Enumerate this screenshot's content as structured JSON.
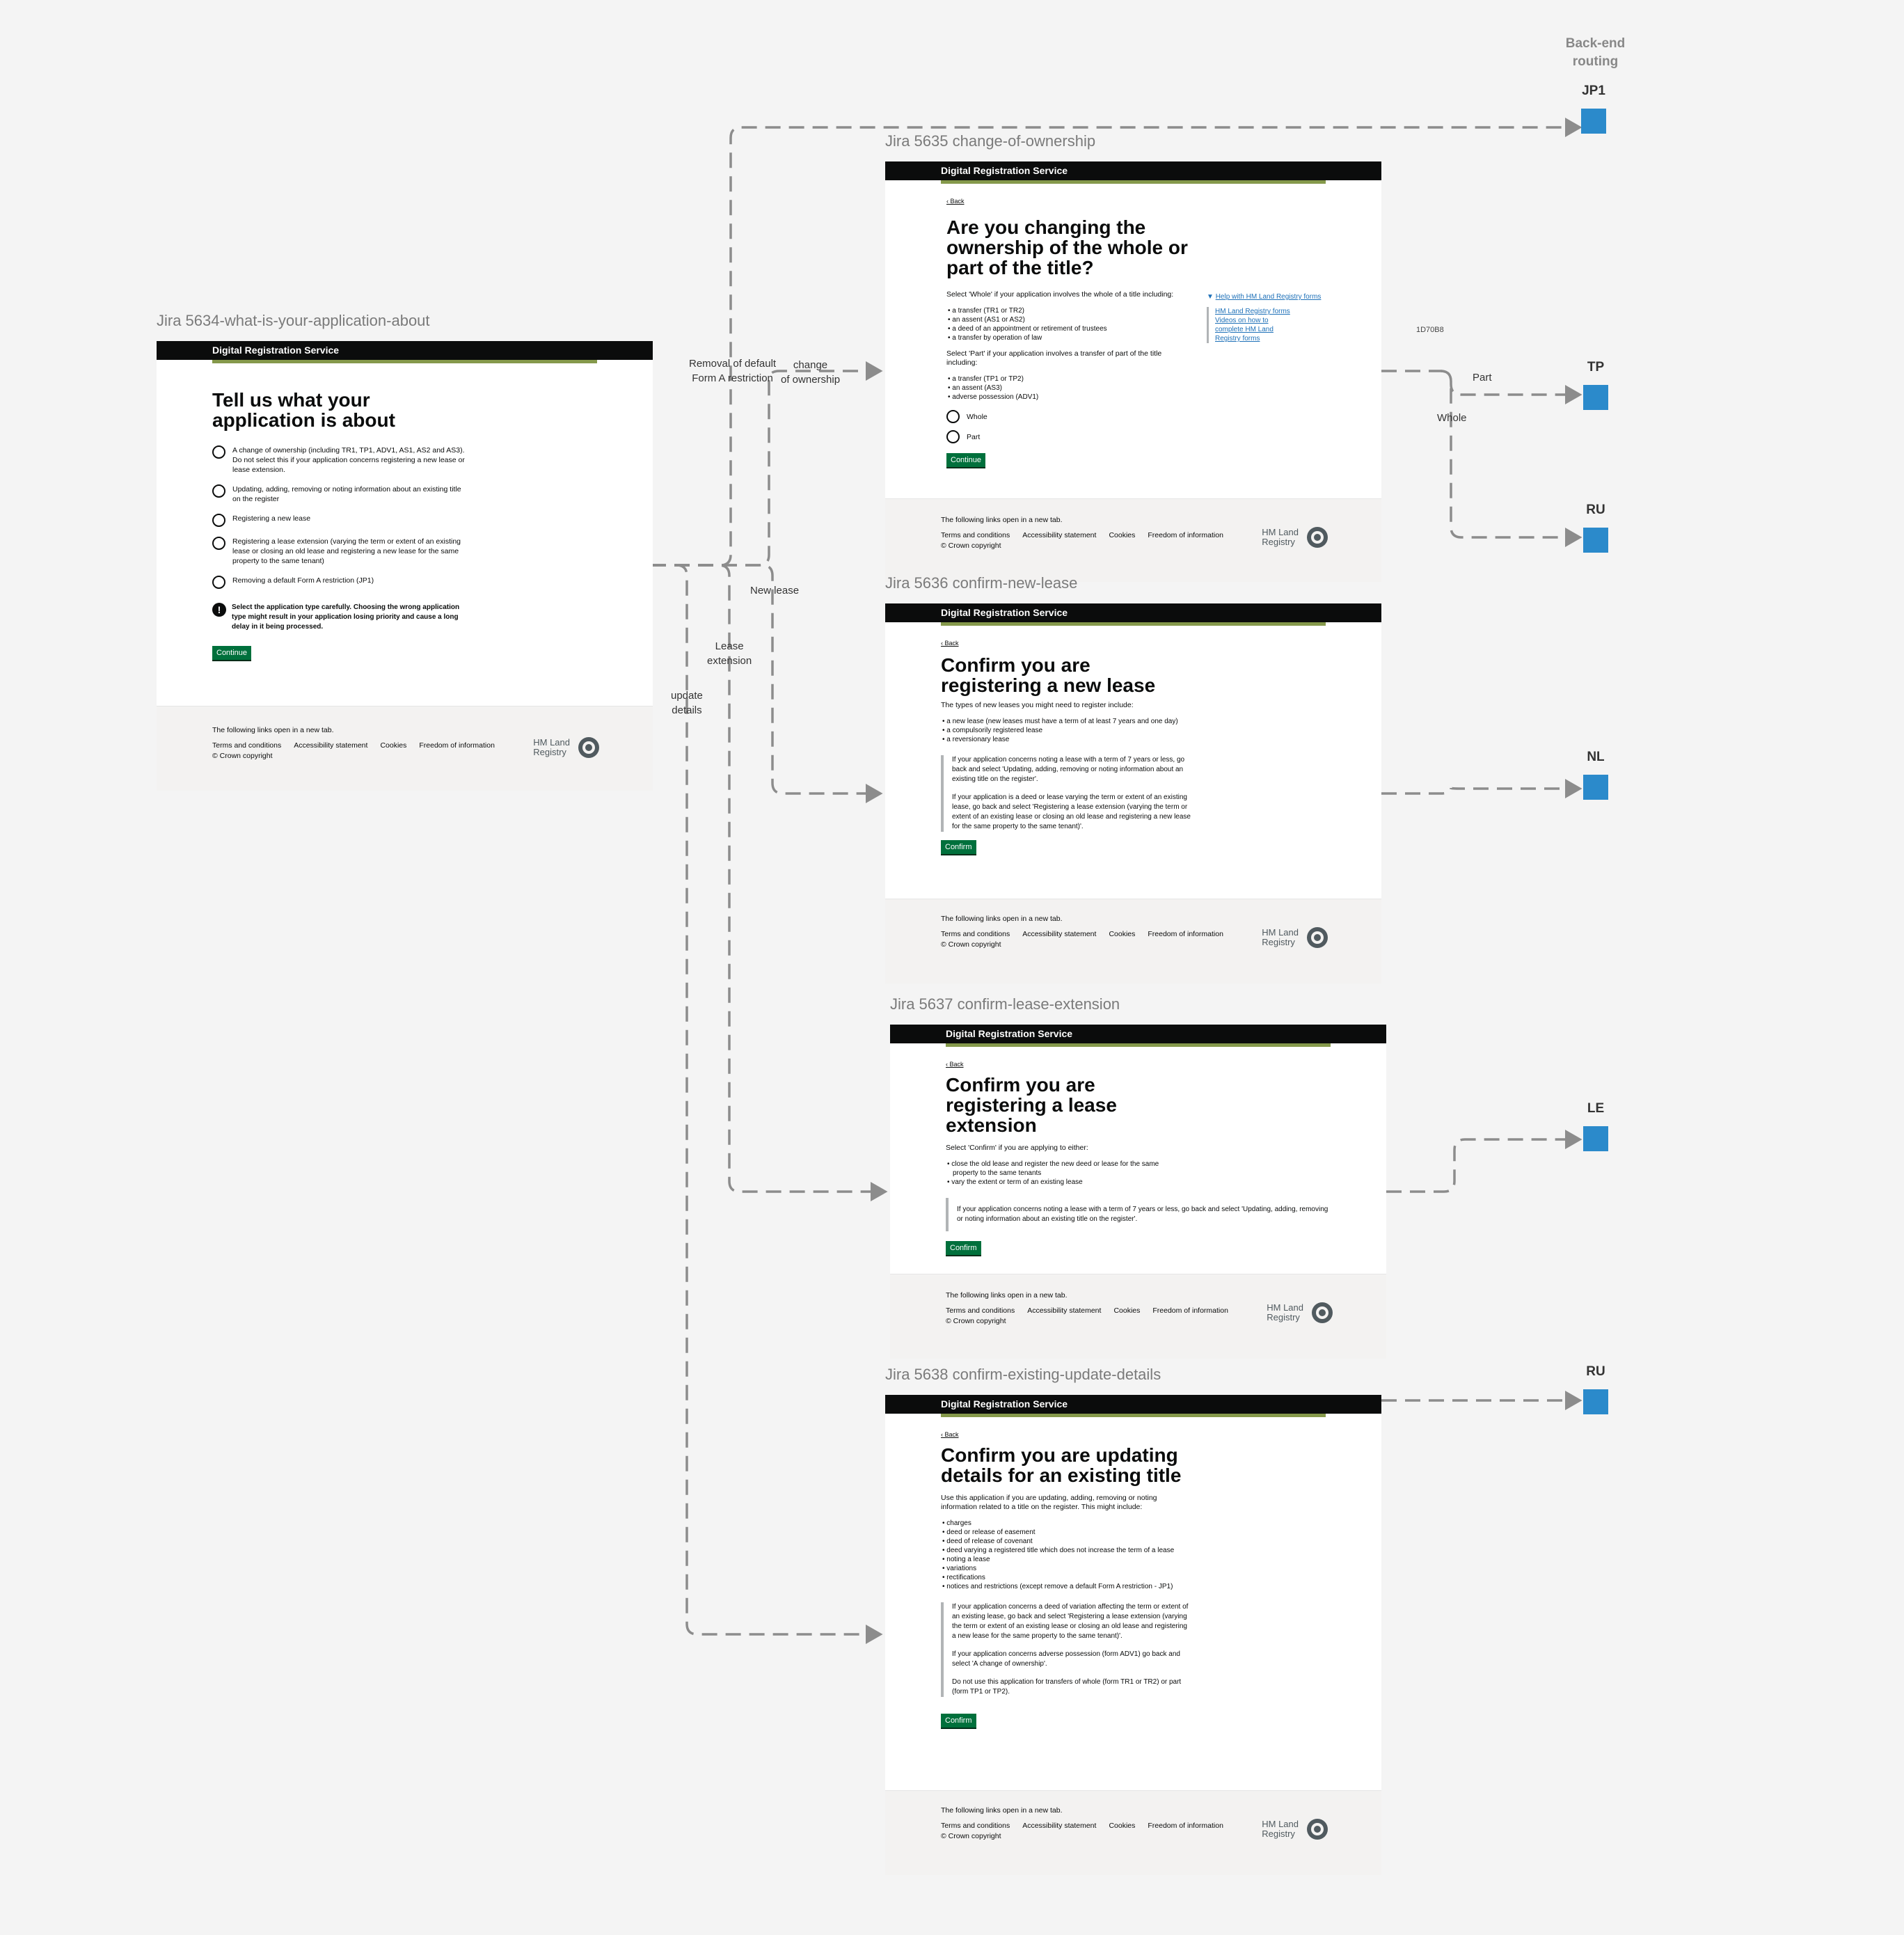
{
  "routing": {
    "title": "Back-end\nrouting",
    "nodes": [
      "JP1",
      "TP",
      "RU",
      "NL",
      "LE",
      "RU"
    ],
    "note": "1D70B8",
    "color": "#2b8acb"
  },
  "flow_labels": {
    "removal": "Removal of default\nForm A restriction",
    "change": "change\nof ownership",
    "new_lease": "New lease",
    "lease_ext": "Lease\nextension",
    "update": "update\ndetails",
    "part": "Part",
    "whole": "Whole"
  },
  "common": {
    "service_name": "Digital Registration Service",
    "back": "Back",
    "footer_intro": "The following links open in a new tab.",
    "footer_links": [
      "Terms and conditions",
      "Accessibility statement",
      "Cookies",
      "Freedom of information"
    ],
    "copyright": "© Crown copyright",
    "logo_text": "HM Land\nRegistry",
    "colors": {
      "header": "#0b0c0c",
      "accent": "#85994b",
      "button": "#00703c",
      "link": "#1d70b8"
    }
  },
  "screens": {
    "s5634": {
      "frame_title": "Jira 5634-what-is-your-application-about",
      "heading": "Tell us what your application is about",
      "options": [
        "A change of ownership (including TR1, TP1, ADV1, AS1, AS2 and AS3). Do not select this if your application concerns registering a new lease or lease extension.",
        "Updating, adding, removing or noting information about an existing title on the register",
        "Registering a new lease",
        "Registering a lease extension (varying the term or extent of an existing lease or closing an old lease and registering a new lease for the same property to the same tenant)",
        "Removing a default Form A restriction (JP1)"
      ],
      "warning": "Select the application type carefully. Choosing the wrong application type might result in your application losing priority and cause a long delay in it being processed.",
      "button": "Continue"
    },
    "s5635": {
      "frame_title": "Jira 5635 change-of-ownership",
      "heading": "Are you changing the ownership of the whole or part of the title?",
      "whole_intro": "Select 'Whole' if your application involves the whole of a title including:",
      "whole_items": [
        "a transfer (TR1 or TR2)",
        "an assent (AS1 or AS2)",
        "a deed of an appointment or retirement of trustees",
        "a transfer by operation of law"
      ],
      "part_intro": "Select 'Part' if your application involves a transfer of part of the title including:",
      "part_items": [
        "a transfer (TP1 or TP2)",
        "an assent (AS3)",
        "adverse possession (ADV1)"
      ],
      "radios": [
        "Whole",
        "Part"
      ],
      "button": "Continue",
      "help_summary": "Help with HM Land Registry forms",
      "help_links": [
        "HM Land Registry forms",
        "Videos on how to complete HM Land Registry forms"
      ]
    },
    "s5636": {
      "frame_title": "Jira 5636 confirm-new-lease",
      "heading": "Confirm you are registering a new lease",
      "intro": "The types of new leases you might need to register include:",
      "items": [
        "a new lease (new leases must have a term of at least 7 years and one day)",
        "a compulsorily registered lease",
        "a reversionary lease"
      ],
      "inset1": "If your application concerns noting a lease with a term of 7 years or less, go back and select 'Updating, adding, removing or noting information about an existing title on the register'.",
      "inset2": "If your application is a deed or lease varying the term or extent of an existing lease, go back and select 'Registering a lease extension (varying the term or extent of an existing lease or closing an old lease and registering a new lease for the same property to the same tenant)'.",
      "button": "Confirm"
    },
    "s5637": {
      "frame_title": "Jira 5637 confirm-lease-extension",
      "heading": "Confirm you are registering a lease extension",
      "intro": "Select 'Confirm' if you are applying to either:",
      "items": [
        "close the old lease and register the new deed or lease for the same property to the same tenants",
        "vary the extent or term of an existing lease"
      ],
      "inset": "If your application concerns noting a lease with a term of 7 years or less, go back and select 'Updating, adding, removing or noting information about an existing title on the register'.",
      "button": "Confirm"
    },
    "s5638": {
      "frame_title": "Jira 5638 confirm-existing-update-details",
      "heading": "Confirm you are updating details for an existing title",
      "intro": "Use this application if you are updating, adding, removing or noting information related to a title on the register. This might include:",
      "items": [
        "charges",
        "deed or release of easement",
        "deed of release of covenant",
        "deed varying a registered title which does not increase the term of a lease",
        "noting a lease",
        "variations",
        "rectifications",
        "notices and restrictions (except remove a default Form A restriction - JP1)"
      ],
      "inset1": "If your application concerns a deed of variation affecting the term or extent of an existing lease, go back and select 'Registering a lease extension (varying the term or extent of an existing lease or closing an old lease and registering a new lease for the same property to the same tenant)'.",
      "inset2": "If your application concerns adverse possession (form ADV1) go back and select 'A change of ownership'.",
      "inset3": "Do not use this application for transfers of whole (form TR1 or TR2) or part (form TP1 or TP2).",
      "button": "Confirm"
    }
  }
}
